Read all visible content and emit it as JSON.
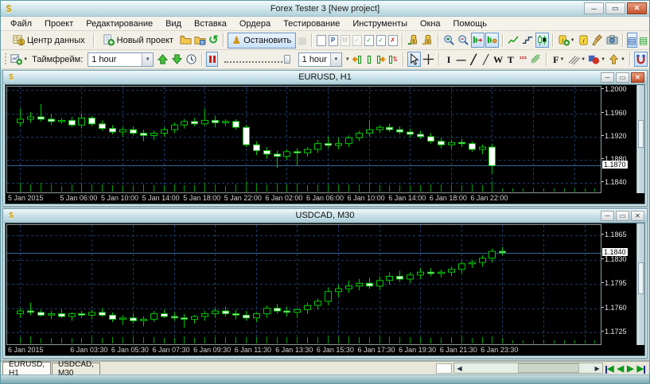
{
  "window": {
    "title": "Forex Tester 3  [New project]"
  },
  "menu": {
    "items": [
      "Файл",
      "Проект",
      "Редактирование",
      "Вид",
      "Вставка",
      "Ордера",
      "Тестирование",
      "Инструменты",
      "Окна",
      "Помощь"
    ]
  },
  "toolbar1": {
    "data_center_label": "Центр данных",
    "new_project_label": "Новый проект",
    "stop_label": "Остановить"
  },
  "toolbar2": {
    "timeframe_label": "Таймфрейм:",
    "timeframe_value": "1 hour",
    "speed_value": "1 hour"
  },
  "icons": [
    "data-center-icon",
    "new-project-icon",
    "open-project-icon",
    "save-project-icon",
    "restart-icon",
    "stop-icon",
    "step-forward-icon",
    "note-icons",
    "deposit-icon",
    "withdraw-icon",
    "zoom-in-icon",
    "zoom-out-icon",
    "autoscroll-icon",
    "chart-shift-icon",
    "line-chart-icon",
    "step-chart-icon",
    "candle-chart-icon",
    "add-indicator-icon",
    "indicator-info-icon",
    "clear-icon",
    "screenshot-icon",
    "data-window-icon",
    "symbol-list-icon",
    "new-chart-icon",
    "timeframe-up-icon",
    "timeframe-down-icon",
    "clock-icon",
    "pause-icon",
    "speed-slider",
    "step-back-candle-icon",
    "step-candle-icon",
    "step-forward-candle-icon",
    "step-tick-icon",
    "cursor-icon",
    "crosshair-icon",
    "vline-icon",
    "hline-icon",
    "trendline-icon",
    "ray-icon",
    "wave-icon",
    "text-icon",
    "fibo-icon",
    "elliott-icon",
    "fibo-group-icon",
    "channels-icon",
    "shapes-icon",
    "arrows-icon",
    "magnet-icon"
  ],
  "bottom_tabs": [
    "EURUSD, H1",
    "USDCAD, M30"
  ],
  "colors": {
    "candle_green": "#00c800",
    "volume_green": "#00a000",
    "grid_blue": "#1e3a6a",
    "price_line_blue": "#3a6496",
    "plot_bg": "#000000",
    "selection_border": "#6a96c8",
    "titlebar_blue": "#c8e0e8"
  },
  "chart_data": [
    {
      "type": "candlestick",
      "symbol": "EURUSD",
      "timeframe": "H1",
      "window_title": "EURUSD, H1",
      "y_ticks": [
        "1.2000",
        "1.1960",
        "1.1920",
        "1.1880",
        "1.1840"
      ],
      "y_max": 1.2006,
      "y_min": 1.1824,
      "current_price": "1.1870",
      "x_labels": [
        {
          "text": "5 Jan 2015",
          "index": 0
        },
        {
          "text": "5 Jan 06:00",
          "index": 6
        },
        {
          "text": "5 Jan 10:00",
          "index": 10
        },
        {
          "text": "5 Jan 14:00",
          "index": 14
        },
        {
          "text": "5 Jan 18:00",
          "index": 18
        },
        {
          "text": "5 Jan 22:00",
          "index": 22
        },
        {
          "text": "6 Jan 02:00",
          "index": 26
        },
        {
          "text": "6 Jan 06:00",
          "index": 30
        },
        {
          "text": "6 Jan 10:00",
          "index": 34
        },
        {
          "text": "6 Jan 14:00",
          "index": 38
        },
        {
          "text": "6 Jan 18:00",
          "index": 42
        },
        {
          "text": "6 Jan 22:00",
          "index": 46
        }
      ],
      "candles": [
        [
          1.1944,
          1.1968,
          1.1938,
          1.195
        ],
        [
          1.195,
          1.1962,
          1.1944,
          1.1954
        ],
        [
          1.1954,
          1.1976,
          1.1946,
          1.195
        ],
        [
          1.195,
          1.1958,
          1.194,
          1.1946
        ],
        [
          1.1946,
          1.1952,
          1.1942,
          1.1948
        ],
        [
          1.1948,
          1.1954,
          1.1936,
          1.194
        ],
        [
          1.194,
          1.196,
          1.1934,
          1.1952
        ],
        [
          1.1952,
          1.1956,
          1.1938,
          1.1942
        ],
        [
          1.1942,
          1.1948,
          1.193,
          1.1934
        ],
        [
          1.1934,
          1.194,
          1.1924,
          1.1928
        ],
        [
          1.1928,
          1.1936,
          1.192,
          1.1932
        ],
        [
          1.1932,
          1.1938,
          1.1922,
          1.1926
        ],
        [
          1.1926,
          1.1932,
          1.1912,
          1.1922
        ],
        [
          1.1922,
          1.193,
          1.1914,
          1.1926
        ],
        [
          1.1926,
          1.1936,
          1.192,
          1.1932
        ],
        [
          1.1932,
          1.1944,
          1.1926,
          1.194
        ],
        [
          1.194,
          1.195,
          1.1934,
          1.1946
        ],
        [
          1.1946,
          1.1952,
          1.1938,
          1.1942
        ],
        [
          1.1942,
          1.1968,
          1.1938,
          1.1948
        ],
        [
          1.1948,
          1.1956,
          1.1936,
          1.1944
        ],
        [
          1.1944,
          1.195,
          1.1938,
          1.1946
        ],
        [
          1.1946,
          1.195,
          1.1932,
          1.1936
        ],
        [
          1.1936,
          1.194,
          1.1902,
          1.1906
        ],
        [
          1.1906,
          1.1912,
          1.1888,
          1.1896
        ],
        [
          1.1896,
          1.1902,
          1.1882,
          1.189
        ],
        [
          1.189,
          1.1896,
          1.1866,
          1.1886
        ],
        [
          1.1886,
          1.1898,
          1.188,
          1.1894
        ],
        [
          1.1894,
          1.19,
          1.187,
          1.1892
        ],
        [
          1.1892,
          1.1902,
          1.1886,
          1.1898
        ],
        [
          1.1898,
          1.1914,
          1.1892,
          1.1908
        ],
        [
          1.1908,
          1.192,
          1.19,
          1.1905
        ],
        [
          1.1905,
          1.1918,
          1.1898,
          1.1908
        ],
        [
          1.1908,
          1.1922,
          1.1902,
          1.1918
        ],
        [
          1.1918,
          1.193,
          1.1912,
          1.1926
        ],
        [
          1.1926,
          1.1948,
          1.192,
          1.1932
        ],
        [
          1.1932,
          1.194,
          1.1926,
          1.1936
        ],
        [
          1.1936,
          1.1942,
          1.1928,
          1.1932
        ],
        [
          1.1932,
          1.1938,
          1.1924,
          1.1928
        ],
        [
          1.1928,
          1.1934,
          1.1918,
          1.1924
        ],
        [
          1.1924,
          1.193,
          1.1916,
          1.192
        ],
        [
          1.192,
          1.1926,
          1.1908,
          1.1912
        ],
        [
          1.1912,
          1.1918,
          1.19,
          1.1906
        ],
        [
          1.1906,
          1.1914,
          1.1898,
          1.191
        ],
        [
          1.191,
          1.1916,
          1.1902,
          1.1908
        ],
        [
          1.1908,
          1.1912,
          1.1894,
          1.1898
        ],
        [
          1.1898,
          1.1906,
          1.189,
          1.1902
        ],
        [
          1.1902,
          1.1908,
          1.1856,
          1.187
        ]
      ]
    },
    {
      "type": "candlestick",
      "symbol": "USDCAD",
      "timeframe": "M30",
      "window_title": "USDCAD, M30",
      "y_ticks": [
        "1.1865",
        "1.1830",
        "1.1795",
        "1.1760",
        "1.1725"
      ],
      "y_max": 1.188,
      "y_min": 1.1708,
      "current_price": "1.1840",
      "x_labels": [
        {
          "text": "6 Jan 2015",
          "index": 0
        },
        {
          "text": "6 Jan 03:30",
          "index": 7
        },
        {
          "text": "6 Jan 05:30",
          "index": 11
        },
        {
          "text": "6 Jan 07:30",
          "index": 15
        },
        {
          "text": "6 Jan 09:30",
          "index": 19
        },
        {
          "text": "6 Jan 11:30",
          "index": 23
        },
        {
          "text": "6 Jan 13:30",
          "index": 27
        },
        {
          "text": "6 Jan 15:30",
          "index": 31
        },
        {
          "text": "6 Jan 17:30",
          "index": 35
        },
        {
          "text": "6 Jan 19:30",
          "index": 39
        },
        {
          "text": "6 Jan 21:30",
          "index": 43
        },
        {
          "text": "6 Jan 23:30",
          "index": 47
        }
      ],
      "candles": [
        [
          1.1752,
          1.176,
          1.1746,
          1.1756
        ],
        [
          1.1756,
          1.1768,
          1.175,
          1.1754
        ],
        [
          1.1754,
          1.1758,
          1.1748,
          1.175
        ],
        [
          1.175,
          1.1756,
          1.1744,
          1.1752
        ],
        [
          1.1752,
          1.1758,
          1.1746,
          1.1748
        ],
        [
          1.1748,
          1.1754,
          1.1742,
          1.1752
        ],
        [
          1.1752,
          1.1756,
          1.1746,
          1.175
        ],
        [
          1.175,
          1.1758,
          1.1744,
          1.1754
        ],
        [
          1.1754,
          1.176,
          1.1748,
          1.175
        ],
        [
          1.175,
          1.1754,
          1.174,
          1.1744
        ],
        [
          1.1744,
          1.175,
          1.1736,
          1.1746
        ],
        [
          1.1746,
          1.1752,
          1.1738,
          1.1742
        ],
        [
          1.1742,
          1.1748,
          1.1734,
          1.1744
        ],
        [
          1.1744,
          1.1756,
          1.174,
          1.1752
        ],
        [
          1.1752,
          1.1758,
          1.1746,
          1.1748
        ],
        [
          1.1748,
          1.1754,
          1.1742,
          1.1746
        ],
        [
          1.1746,
          1.1752,
          1.1732,
          1.1744
        ],
        [
          1.1744,
          1.175,
          1.1738,
          1.1748
        ],
        [
          1.1748,
          1.1756,
          1.1742,
          1.1752
        ],
        [
          1.1752,
          1.176,
          1.1746,
          1.1756
        ],
        [
          1.1756,
          1.1762,
          1.1748,
          1.1752
        ],
        [
          1.1752,
          1.1758,
          1.1744,
          1.175
        ],
        [
          1.175,
          1.1756,
          1.1742,
          1.1746
        ],
        [
          1.1746,
          1.1754,
          1.174,
          1.1752
        ],
        [
          1.1752,
          1.1764,
          1.1746,
          1.176
        ],
        [
          1.176,
          1.1766,
          1.1752,
          1.1756
        ],
        [
          1.1756,
          1.1762,
          1.1748,
          1.1754
        ],
        [
          1.1754,
          1.176,
          1.1746,
          1.1758
        ],
        [
          1.1758,
          1.1768,
          1.1752,
          1.1764
        ],
        [
          1.1764,
          1.1774,
          1.1758,
          1.177
        ],
        [
          1.177,
          1.179,
          1.1764,
          1.1784
        ],
        [
          1.1784,
          1.1794,
          1.1776,
          1.1788
        ],
        [
          1.1788,
          1.18,
          1.1782,
          1.1792
        ],
        [
          1.1792,
          1.1802,
          1.1786,
          1.1796
        ],
        [
          1.1796,
          1.1804,
          1.1788,
          1.1792
        ],
        [
          1.1792,
          1.1806,
          1.1786,
          1.18
        ],
        [
          1.18,
          1.1812,
          1.1794,
          1.1806
        ],
        [
          1.1806,
          1.1814,
          1.1798,
          1.1802
        ],
        [
          1.1802,
          1.1812,
          1.1796,
          1.1808
        ],
        [
          1.1808,
          1.1818,
          1.1802,
          1.1812
        ],
        [
          1.1812,
          1.1818,
          1.1806,
          1.181
        ],
        [
          1.181,
          1.1816,
          1.1804,
          1.1812
        ],
        [
          1.1812,
          1.182,
          1.1806,
          1.1816
        ],
        [
          1.1816,
          1.1828,
          1.181,
          1.1824
        ],
        [
          1.1824,
          1.183,
          1.1818,
          1.1826
        ],
        [
          1.1826,
          1.1836,
          1.182,
          1.1832
        ],
        [
          1.1832,
          1.1846,
          1.1826,
          1.1842
        ],
        [
          1.1842,
          1.1848,
          1.1836,
          1.184
        ]
      ]
    }
  ]
}
